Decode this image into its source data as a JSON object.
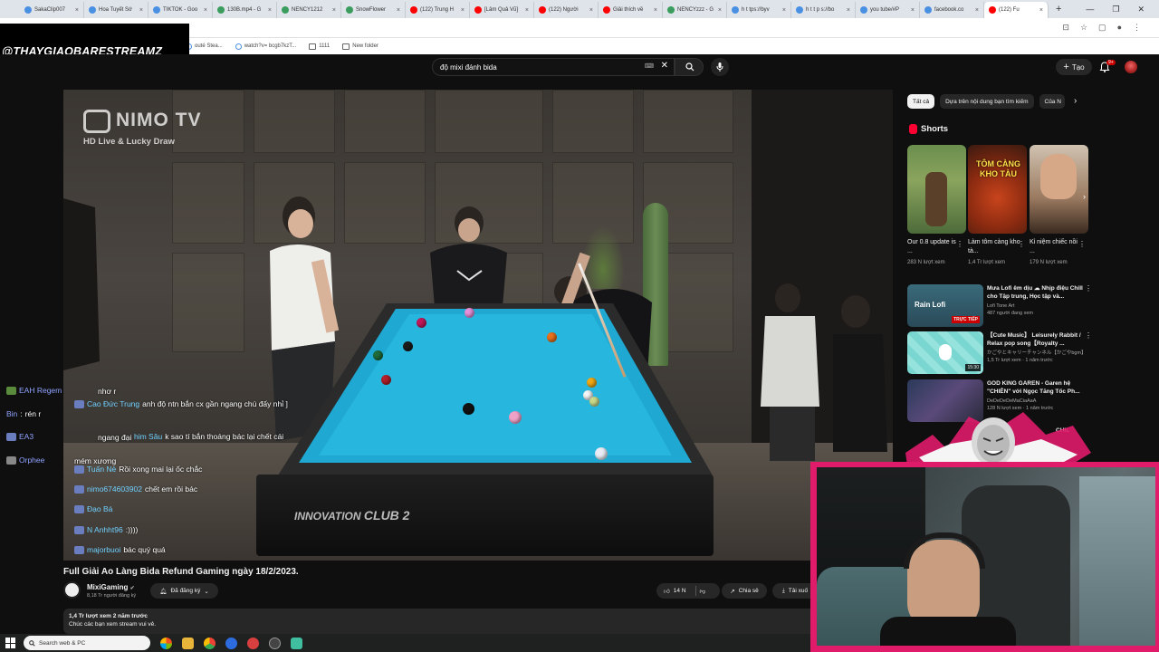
{
  "browser": {
    "tabs": [
      {
        "label": "SakaClip007",
        "color": "#4a90e2"
      },
      {
        "label": "Hoa Tuyết Sớ",
        "color": "#4a90e2"
      },
      {
        "label": "TIKTOK - Goo",
        "color": "#4a90e2"
      },
      {
        "label": "130B.mp4 - G",
        "color": "#3a9d5d"
      },
      {
        "label": "NENCY1212",
        "color": "#3a9d5d"
      },
      {
        "label": "SnowFlower",
        "color": "#3a9d5d"
      },
      {
        "label": "(122) Trung H",
        "color": "#ff0000"
      },
      {
        "label": "[Lâm Quả Vũ]",
        "color": "#ff0000"
      },
      {
        "label": "(122) Người",
        "color": "#ff0000"
      },
      {
        "label": "Giải thích về",
        "color": "#ff0000"
      },
      {
        "label": "NENCYzzz - G",
        "color": "#3a9d5d"
      },
      {
        "label": "h t tps://byv",
        "color": "#4a90e2"
      },
      {
        "label": "h t t p s://bo",
        "color": "#4a90e2"
      },
      {
        "label": "you tube/#P",
        "color": "#4a90e2"
      },
      {
        "label": "facebook.co",
        "color": "#4a90e2"
      },
      {
        "label": "(122) Fu",
        "color": "#ff0000"
      }
    ],
    "new_tab": "+",
    "window_controls": {
      "minimize": "—",
      "maximize": "❐",
      "close": "✕"
    },
    "bookmarks": [
      {
        "label": "outé Stea...",
        "type": "page"
      },
      {
        "label": "watch?v= bcgb7kzT...",
        "type": "page"
      },
      {
        "label": "1111",
        "type": "folder"
      },
      {
        "label": "New folder",
        "type": "folder"
      }
    ]
  },
  "watermark": "@THAYGIAOBARESTREAMZ",
  "youtube": {
    "search_query": "độ mixi đánh bida",
    "create_label": "Tạo",
    "notification_count": "9+",
    "video": {
      "overlay_brand": "NIMO TV",
      "overlay_sub": "HD Live & Lucky Draw",
      "table_brand": "INNOVATION",
      "table_model": "CLUB 2",
      "title": "Full Giải Ao Làng Bida Refund Gaming ngày 18/2/2023.",
      "channel": "MixiGaming",
      "subscribers": "8,18 Tr người đăng ký",
      "subscribe_label": "Đã đăng ký",
      "likes": "14 N",
      "share_label": "Chia sẻ",
      "download_label": "Tải xuố",
      "views": "1,4 Tr lượt xem  2 năm trước",
      "description": "Chúc các bạn xem stream vui vẻ."
    },
    "chat": [
      {
        "name": "EAH Regem",
        "msg": "nhơ r"
      },
      {
        "name": "Cao Đức Trung",
        "msg": "anh độ ntn bắn cx gần ngang chú đấy nhỉ ]"
      },
      {
        "name": "Bin",
        "msg": "rén r"
      },
      {
        "name": "EA3",
        "msg": "ngang đại"
      },
      {
        "name": "him Sâu",
        "msg": "k sao tí bắn thoáng bác lại chết cái"
      },
      {
        "name": "Orphee",
        "msg": "mém xương"
      },
      {
        "name": "Tuấn Nè",
        "msg": "Rồi xong mai lại ốc chắc"
      },
      {
        "name": "nimo674603902",
        "msg": "chết em rồi bác"
      },
      {
        "name": "Đạo Bá",
        "msg": ":))"
      },
      {
        "name": "N Anhht96",
        "msg": ":))))"
      },
      {
        "name": "majorbuoi",
        "msg": "bác quý quá"
      }
    ],
    "chips": [
      "Tất cả",
      "Dựa trên nội dung bạn tìm kiếm",
      "Của N"
    ],
    "shorts_header": "Shorts",
    "shorts": [
      {
        "title": "Our 0.8 update is ...",
        "views": "283 N lượt xem"
      },
      {
        "title": "Làm tôm càng kho tà...",
        "views": "1,4 Tr lượt xem"
      },
      {
        "title": "Kỉ niệm chiếc nồi ...",
        "views": "179 N lượt xem"
      }
    ],
    "short_overlay": "TÔM CÀNG KHO TÀU",
    "recommendations": [
      {
        "title": "Mưa Lofi êm dịu ☁ Nhịp điệu Chill cho Tập trung, Học tập và...",
        "channel": "Lofi Tone Art",
        "meta": "487 người đang xem",
        "badge": "TRỰC TIẾP",
        "thumb_text": "Rain Lofi"
      },
      {
        "title": "【Cute Music】 Leisurely Rabbit / Relax pop song【Royalty ...",
        "channel": "かごやとキャリーチャンネル【かごやbgm】",
        "meta": "1,5 Tr lượt xem · 1 năm trước",
        "badge": "15:30",
        "thumb_text": ""
      },
      {
        "title": "GOD KING GAREN - Garen hệ \"CHIÊN\" với Ngọc Tăng Tốc Ph...",
        "channel": "DeDeDeDeMaCiaAaA",
        "meta": "128 N lượt xem · 1 năm trước",
        "badge": "",
        "thumb_text": ""
      }
    ],
    "partial_rec_text": "CHIL"
  },
  "taskbar": {
    "search_placeholder": "Search web & PC"
  }
}
